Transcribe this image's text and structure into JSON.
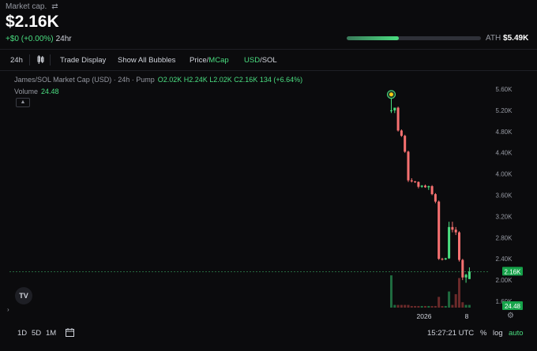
{
  "header": {
    "label": "Market cap.",
    "swap_icon": "⇄",
    "value": "$2.16K",
    "change": "+$0 (+0.00%)",
    "period": "24hr",
    "ath_label": "ATH",
    "ath_value": "$5.49K",
    "ath_progress": 0.39
  },
  "toolbar": {
    "interval": "24h",
    "trade_display": "Trade Display",
    "show_bubbles": "Show All Bubbles",
    "price_label": "Price",
    "price_sep": "/",
    "mcap_label": "MCap",
    "usd_label": "USD",
    "currency_sep": "/",
    "sol_label": "SOL"
  },
  "legend": {
    "title": "James/SOL Market Cap (USD) · 24h · Pump",
    "ohlc": "O2.02K H2.24K L2.02K C2.16K 134 (+6.64%)",
    "volume_label": "Volume",
    "volume_value": "24.48",
    "collapse_icon": "chevron-up-icon"
  },
  "chart_data": {
    "type": "candlestick",
    "y_ticks": [
      "5.60K",
      "5.20K",
      "4.80K",
      "4.40K",
      "4.00K",
      "3.60K",
      "3.20K",
      "2.80K",
      "2.40K",
      "2.00K",
      "1.60K"
    ],
    "ylim": [
      1.6,
      5.6
    ],
    "x_ticks": [
      "2026",
      "8"
    ],
    "last_price_label": "2.16K",
    "last_price": 2.16,
    "volume_label": "24.48",
    "candles": [
      {
        "o": 5.2,
        "h": 5.5,
        "l": 5.15,
        "c": 5.2
      },
      {
        "o": 5.2,
        "h": 5.25,
        "l": 5.15,
        "c": 5.25
      },
      {
        "o": 5.25,
        "h": 5.27,
        "l": 4.8,
        "c": 4.82
      },
      {
        "o": 4.82,
        "h": 4.84,
        "l": 4.7,
        "c": 4.72
      },
      {
        "o": 4.72,
        "h": 4.74,
        "l": 4.4,
        "c": 4.42
      },
      {
        "o": 4.42,
        "h": 4.44,
        "l": 3.85,
        "c": 3.88
      },
      {
        "o": 3.88,
        "h": 3.92,
        "l": 3.84,
        "c": 3.86
      },
      {
        "o": 3.86,
        "h": 3.87,
        "l": 3.83,
        "c": 3.85
      },
      {
        "o": 3.85,
        "h": 3.86,
        "l": 3.73,
        "c": 3.76
      },
      {
        "o": 3.76,
        "h": 3.79,
        "l": 3.74,
        "c": 3.78
      },
      {
        "o": 3.78,
        "h": 3.8,
        "l": 3.74,
        "c": 3.75
      },
      {
        "o": 3.75,
        "h": 3.78,
        "l": 3.7,
        "c": 3.77
      },
      {
        "o": 3.77,
        "h": 3.79,
        "l": 3.6,
        "c": 3.62
      },
      {
        "o": 3.62,
        "h": 3.64,
        "l": 3.45,
        "c": 3.48
      },
      {
        "o": 3.48,
        "h": 3.5,
        "l": 2.38,
        "c": 2.4
      },
      {
        "o": 2.4,
        "h": 2.42,
        "l": 2.37,
        "c": 2.39
      },
      {
        "o": 2.39,
        "h": 2.42,
        "l": 2.38,
        "c": 2.41
      },
      {
        "o": 2.41,
        "h": 3.1,
        "l": 2.4,
        "c": 3.0
      },
      {
        "o": 3.0,
        "h": 3.1,
        "l": 2.9,
        "c": 2.95
      },
      {
        "o": 2.95,
        "h": 3.0,
        "l": 2.85,
        "c": 2.9
      },
      {
        "o": 2.9,
        "h": 2.92,
        "l": 2.35,
        "c": 2.38
      },
      {
        "o": 2.38,
        "h": 2.4,
        "l": 2.0,
        "c": 2.05
      },
      {
        "o": 2.05,
        "h": 2.12,
        "l": 1.95,
        "c": 2.1
      },
      {
        "o": 2.02,
        "h": 2.24,
        "l": 2.02,
        "c": 2.16
      }
    ],
    "volumes": [
      6,
      0.5,
      0.5,
      0.5,
      0.5,
      0.5,
      0.3,
      0.3,
      0.3,
      0.3,
      0.3,
      0.3,
      0.3,
      0.3,
      2.0,
      0.3,
      0.3,
      3.0,
      0.5,
      2.5,
      5.5,
      1.0,
      0.5,
      0.5
    ],
    "volume_max": 11,
    "colors": {
      "up": "#4ade80",
      "down": "#f87171",
      "up_vol": "#1f6b3f",
      "down_vol": "#6b2a2a"
    }
  },
  "bottom_bar": {
    "range_1d": "1D",
    "range_5d": "5D",
    "range_1m": "1M",
    "date_icon": "calendar-icon",
    "time": "15:27:21 UTC",
    "percent": "%",
    "log": "log",
    "auto": "auto"
  },
  "logo_text": "TV"
}
